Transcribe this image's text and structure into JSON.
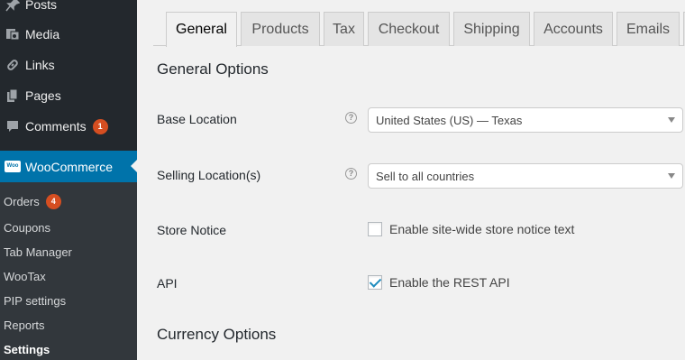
{
  "sidebar": {
    "items": [
      {
        "label": "Posts",
        "icon": "pin-icon"
      },
      {
        "label": "Media",
        "icon": "media-icon"
      },
      {
        "label": "Links",
        "icon": "link-icon"
      },
      {
        "label": "Pages",
        "icon": "pages-icon"
      },
      {
        "label": "Comments",
        "icon": "comment-icon",
        "badge": "1"
      }
    ],
    "woocommerce": {
      "label": "WooCommerce",
      "logo_text": "Woo"
    },
    "submenu": [
      {
        "label": "Orders",
        "badge": "4"
      },
      {
        "label": "Coupons"
      },
      {
        "label": "Tab Manager"
      },
      {
        "label": "WooTax"
      },
      {
        "label": "PIP settings"
      },
      {
        "label": "Reports"
      },
      {
        "label": "Settings"
      }
    ]
  },
  "tabs": [
    "General",
    "Products",
    "Tax",
    "Checkout",
    "Shipping",
    "Accounts",
    "Emails"
  ],
  "active_tab": "General",
  "general": {
    "heading": "General Options",
    "base_location": {
      "label": "Base Location",
      "value": "United States (US) — Texas"
    },
    "selling_locations": {
      "label": "Selling Location(s)",
      "value": "Sell to all countries"
    },
    "store_notice": {
      "label": "Store Notice",
      "checkbox_label": "Enable site-wide store notice text",
      "checked": false
    },
    "api": {
      "label": "API",
      "checkbox_label": "Enable the REST API",
      "checked": true
    }
  },
  "currency": {
    "heading": "Currency Options"
  },
  "help_glyph": "?",
  "colors": {
    "sidebar": "#23282d",
    "submenu": "#32373c",
    "accent": "#0073aa",
    "badge": "#d54e21"
  }
}
